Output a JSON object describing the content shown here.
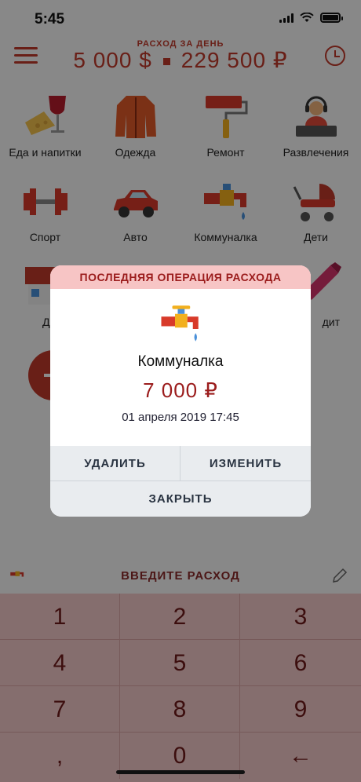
{
  "status": {
    "time": "5:45"
  },
  "header": {
    "daily_label": "РАСХОД ЗА ДЕНЬ",
    "total_usd": "5 000 $",
    "total_rub": "229 500 ₽"
  },
  "categories": [
    {
      "label": "Еда и напитки",
      "icon": "food-drink-icon"
    },
    {
      "label": "Одежда",
      "icon": "jacket-icon"
    },
    {
      "label": "Ремонт",
      "icon": "paint-roller-icon"
    },
    {
      "label": "Развлечения",
      "icon": "dj-icon"
    },
    {
      "label": "Спорт",
      "icon": "dumbbell-icon"
    },
    {
      "label": "Авто",
      "icon": "car-icon"
    },
    {
      "label": "Коммуналка",
      "icon": "faucet-icon"
    },
    {
      "label": "Дети",
      "icon": "stroller-icon"
    },
    {
      "label": "Д",
      "icon": "house-icon"
    },
    {
      "label": "дит",
      "icon": "lipstick-icon"
    }
  ],
  "entry": {
    "label": "ВВЕДИТЕ РАСХОД"
  },
  "keypad": {
    "keys": [
      "1",
      "2",
      "3",
      "4",
      "5",
      "6",
      "7",
      "8",
      "9",
      ",",
      "0",
      "←"
    ]
  },
  "dialog": {
    "title": "ПОСЛЕДНЯЯ ОПЕРАЦИЯ РАСХОДА",
    "category": "Коммуналка",
    "amount": "7 000 ₽",
    "date": "01 апреля 2019 17:45",
    "delete_label": "УДАЛИТЬ",
    "edit_label": "ИЗМЕНИТЬ",
    "close_label": "ЗАКРЫТЬ"
  },
  "colors": {
    "accent": "#c0392b",
    "dialog_title_bg": "#f7c5c5",
    "keypad_bg": "#f3c9c9",
    "amount": "#9b1c1c"
  }
}
